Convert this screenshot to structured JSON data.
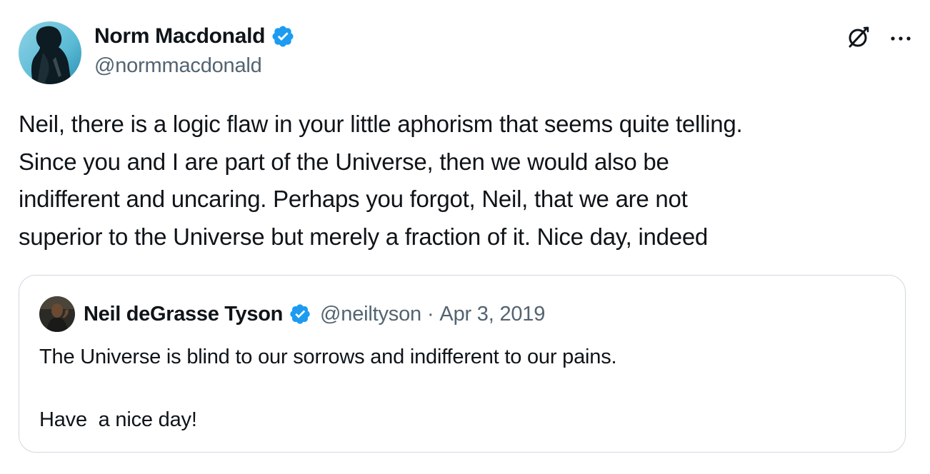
{
  "tweet": {
    "author": {
      "display_name": "Norm Macdonald",
      "handle": "@normmacdonald",
      "verified": true,
      "avatar_icon": "avatar-silhouette"
    },
    "actions": {
      "grok_icon": "grok-icon",
      "more_icon": "more-horizontal-icon"
    },
    "text": "Neil, there is a logic flaw in your little aphorism that seems quite telling.\nSince you and I are part of the Universe, then we would also be\nindifferent and uncaring. Perhaps you forgot, Neil, that we are not\nsuperior to the Universe but merely a fraction of it. Nice day, indeed"
  },
  "quoted_tweet": {
    "author": {
      "display_name": "Neil deGrasse Tyson",
      "handle": "@neiltyson",
      "verified": true
    },
    "separator": "·",
    "date": "Apr 3, 2019",
    "text": "The Universe is blind to our sorrows and indifferent to our pains.\n\nHave  a nice day!"
  },
  "colors": {
    "text_primary": "#0f1419",
    "text_secondary": "#536471",
    "verified_blue": "#1d9bf0",
    "border": "#cfd9de"
  }
}
